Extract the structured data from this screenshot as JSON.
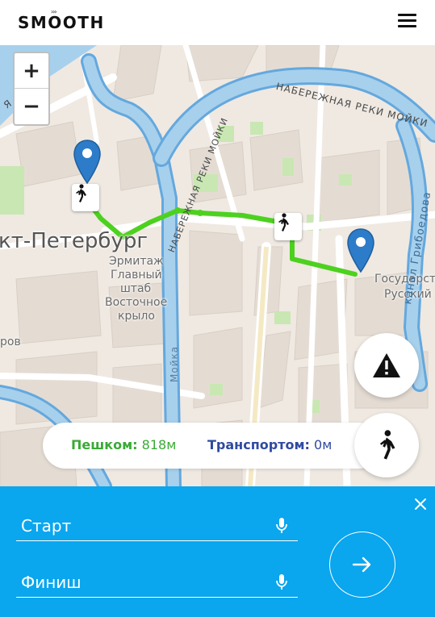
{
  "app": {
    "logo_text": "SMOOTH",
    "logo_mark": "›››",
    "menu_icon": "hamburger-menu-icon"
  },
  "map": {
    "zoom_in_label": "+",
    "zoom_out_label": "−",
    "labels": {
      "city": "кт-Петербург",
      "place1_line1": "Эрмитаж",
      "place1_line2": "Главный",
      "place1_line3": "штаб",
      "place1_line4": "Восточное",
      "place1_line5": "крыло",
      "place2_line1": "Государст",
      "place2_line2": "Русский",
      "fragment_rov": "ров",
      "street_top_left": "Я НАЯ",
      "street_moika_top": "НАБЕРЕЖНАЯ РЕКИ МОЙКИ",
      "street_moika_diag": "НАБЕРЕЖНАЯ РЕКИ МОЙКИ",
      "street_moika_vertical": "Мойка",
      "street_griboedova": "канал Грибоедова"
    },
    "colors": {
      "land": "#efe9e2",
      "water": "#a7d0ec",
      "water_stroke": "#64a8de",
      "road": "#ffffff",
      "route": "#4dd11f",
      "park": "#c9e7b2",
      "pin": "#2c7cc9"
    }
  },
  "stats": {
    "walk_label": "Пешком:",
    "walk_value": "818м",
    "transport_label": "Транспортом:",
    "transport_value": "0м"
  },
  "buttons": {
    "report_icon": "warning-icon",
    "walk_mode_icon": "walking-person-icon"
  },
  "panel": {
    "start_placeholder": "Старт",
    "finish_placeholder": "Финиш",
    "close_icon": "close-icon",
    "mic_icon": "microphone-icon",
    "go_icon": "arrow-right-icon"
  }
}
